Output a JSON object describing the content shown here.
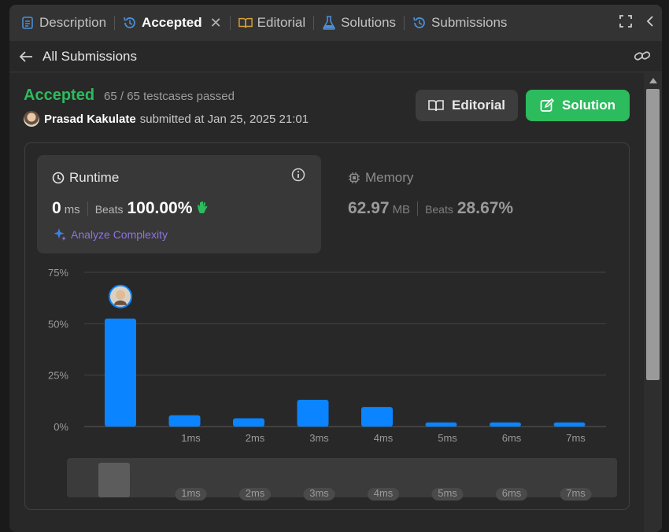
{
  "tabs": [
    {
      "label": "Description",
      "icon": "description-icon",
      "active": false
    },
    {
      "label": "Accepted",
      "icon": "history-icon",
      "active": true
    },
    {
      "label": "Editorial",
      "icon": "book-icon",
      "active": false
    },
    {
      "label": "Solutions",
      "icon": "flask-icon",
      "active": false
    },
    {
      "label": "Submissions",
      "icon": "history-icon",
      "active": false
    }
  ],
  "subheader": {
    "title": "All Submissions"
  },
  "status": {
    "label": "Accepted",
    "cases": "65 / 65 testcases passed"
  },
  "submitter": {
    "name": "Prasad Kakulate",
    "submitted_at": "submitted at Jan 25, 2025 21:01"
  },
  "buttons": {
    "editorial": "Editorial",
    "solution": "Solution"
  },
  "runtime": {
    "title": "Runtime",
    "value": "0",
    "unit": "ms",
    "beats_label": "Beats",
    "beats_value": "100.00%",
    "analyze": "Analyze Complexity"
  },
  "memory": {
    "title": "Memory",
    "value": "62.97",
    "unit": "MB",
    "beats_label": "Beats",
    "beats_value": "28.67%"
  },
  "colors": {
    "accent_green": "#2cbb5d",
    "bar_blue": "#0a84ff",
    "analyze_purple": "#8d74e0"
  },
  "chart_data": {
    "type": "bar",
    "categories": [
      "",
      "1ms",
      "2ms",
      "3ms",
      "4ms",
      "5ms",
      "6ms",
      "7ms"
    ],
    "values": [
      52.5,
      5.5,
      4,
      13,
      9.5,
      2,
      2,
      2
    ],
    "yticks": [
      "75%",
      "50%",
      "25%",
      "0%"
    ],
    "ylim": [
      0,
      75
    ],
    "highlight_index": 0,
    "overview_labels": [
      "1ms",
      "2ms",
      "3ms",
      "4ms",
      "5ms",
      "6ms",
      "7ms"
    ],
    "grid": true
  }
}
